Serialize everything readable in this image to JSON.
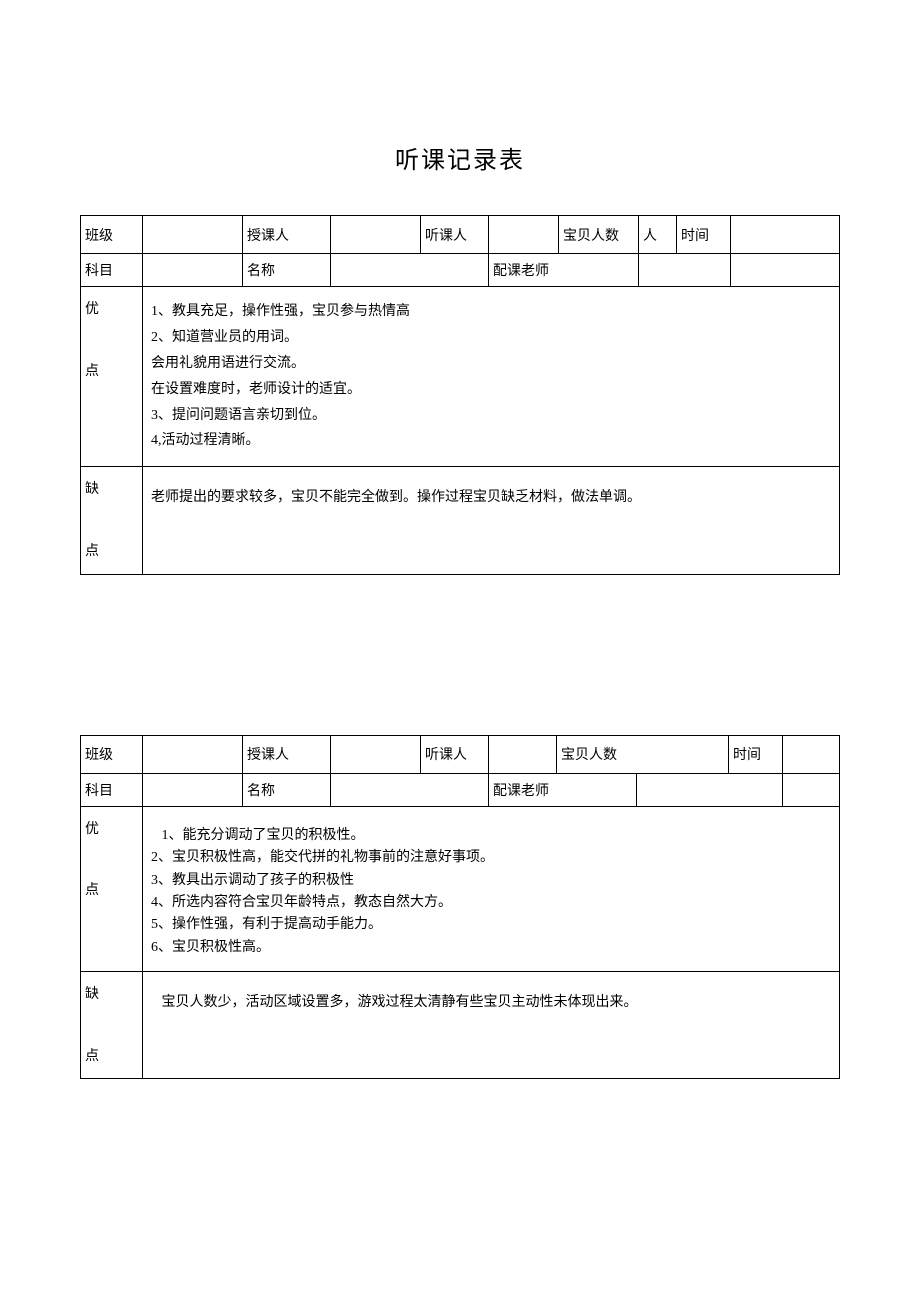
{
  "title": "听课记录表",
  "table1": {
    "row1": {
      "class_label": "班级",
      "class_value": "",
      "lecturer_label": "授课人",
      "lecturer_value": "",
      "listener_label": "听课人",
      "listener_value": "",
      "count_label": "宝贝人数",
      "count_value": "人",
      "time_label": "时间",
      "time_value": ""
    },
    "row2": {
      "subject_label": "科目",
      "subject_value": "",
      "name_label": "名称",
      "name_value": "",
      "coteacher_label": "配课老师",
      "coteacher_value": "",
      "extra_value": ""
    },
    "advantages_label_1": "优",
    "advantages_label_2": "点",
    "advantages_lines": [
      "1、教具充足，操作性强，宝贝参与热情高",
      "2、知道营业员的用词。",
      "会用礼貌用语进行交流。",
      "在设置难度时，老师设计的适宜。",
      "3、提问问题语言亲切到位。",
      "4,活动过程清晰。"
    ],
    "disadvantages_label_1": "缺",
    "disadvantages_label_2": "点",
    "disadvantages_text": "老师提出的要求较多，宝贝不能完全做到。操作过程宝贝缺乏材料，做法单调。"
  },
  "table2": {
    "row1": {
      "class_label": "班级",
      "class_value": "",
      "lecturer_label": "授课人",
      "lecturer_value": "",
      "listener_label": "听课人",
      "listener_value": "",
      "count_label": "宝贝人数",
      "count_value": "",
      "time_label": "时间",
      "time_value": ""
    },
    "row2": {
      "subject_label": "科目",
      "subject_value": "",
      "name_label": "名称",
      "name_value": "",
      "coteacher_label": "配课老师",
      "coteacher_value": "",
      "extra_value": ""
    },
    "advantages_label_1": "优",
    "advantages_label_2": "点",
    "advantages_lines": [
      "   1、能充分调动了宝贝的积极性。",
      "2、宝贝积极性高，能交代拼的礼物事前的注意好事项。",
      "3、教具出示调动了孩子的积极性",
      "4、所选内容符合宝贝年龄特点，教态自然大方。",
      "5、操作性强，有利于提高动手能力。",
      "6、宝贝积极性高。"
    ],
    "disadvantages_label_1": "缺",
    "disadvantages_label_2": "点",
    "disadvantages_text": "   宝贝人数少，活动区域设置多，游戏过程太清静有些宝贝主动性未体现出来。"
  }
}
